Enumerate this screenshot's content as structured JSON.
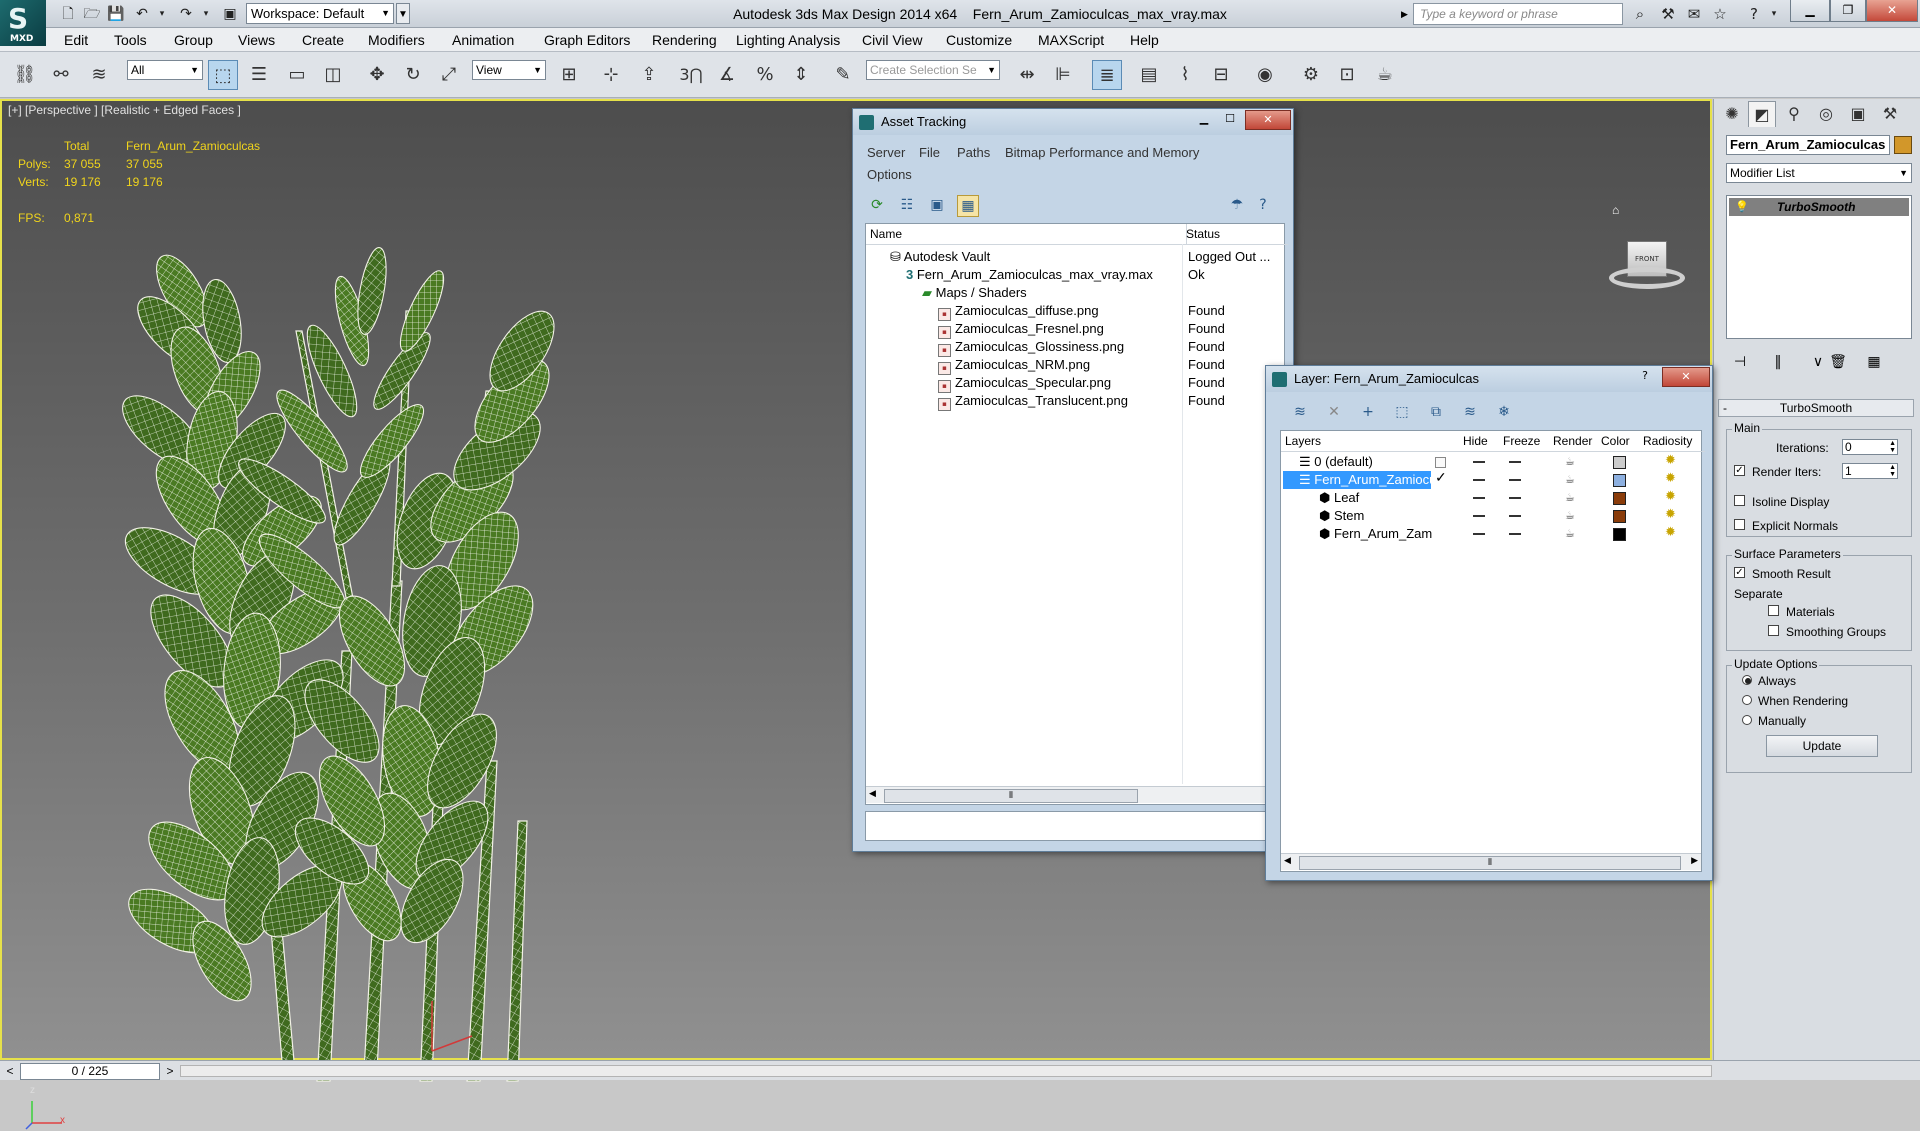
{
  "titlebar": {
    "app_title": "Autodesk 3ds Max Design 2014 x64",
    "file_title": "Fern_Arum_Zamioculcas_max_vray.max",
    "workspace": "Workspace: Default",
    "search_placeholder": "Type a keyword or phrase",
    "logo_text": "MXD"
  },
  "menu": [
    "Edit",
    "Tools",
    "Group",
    "Views",
    "Create",
    "Modifiers",
    "Animation",
    "Graph Editors",
    "Rendering",
    "Lighting Analysis",
    "Civil View",
    "Customize",
    "MAXScript",
    "Help"
  ],
  "toolbar": {
    "filter": "All",
    "ref_coord": "View",
    "selection_set": "Create Selection Se",
    "snap_label": "3"
  },
  "viewport": {
    "label": "[+] [Perspective ] [Realistic + Edged Faces ]",
    "stats": {
      "total_label": "Total",
      "object_label": "Fern_Arum_Zamioculcas",
      "polys_label": "Polys:",
      "polys_total": "37 055",
      "polys_object": "37 055",
      "verts_label": "Verts:",
      "verts_total": "19 176",
      "verts_object": "19 176",
      "fps_label": "FPS:",
      "fps_value": "0,871"
    },
    "viewcube_face": "FRONT",
    "axis_z": "z",
    "axis_x": "x"
  },
  "timeline": {
    "position": "0 / 225",
    "prev": "<",
    "next": ">"
  },
  "asset_tracking": {
    "title": "Asset Tracking",
    "menu": [
      "Server",
      "File",
      "Paths",
      "Bitmap Performance and Memory",
      "Options"
    ],
    "columns": {
      "name": "Name",
      "status": "Status"
    },
    "rows": [
      {
        "name": "Autodesk Vault",
        "status": "Logged Out ..."
      },
      {
        "name": "Fern_Arum_Zamioculcas_max_vray.max",
        "status": "Ok"
      },
      {
        "name": "Maps / Shaders",
        "status": ""
      },
      {
        "name": "Zamioculcas_diffuse.png",
        "status": "Found"
      },
      {
        "name": "Zamioculcas_Fresnel.png",
        "status": "Found"
      },
      {
        "name": "Zamioculcas_Glossiness.png",
        "status": "Found"
      },
      {
        "name": "Zamioculcas_NRM.png",
        "status": "Found"
      },
      {
        "name": "Zamioculcas_Specular.png",
        "status": "Found"
      },
      {
        "name": "Zamioculcas_Translucent.png",
        "status": "Found"
      }
    ]
  },
  "layer_dialog": {
    "title": "Layer: Fern_Arum_Zamioculcas",
    "help": "?",
    "columns": {
      "layers": "Layers",
      "hide": "Hide",
      "freeze": "Freeze",
      "render": "Render",
      "color": "Color",
      "radiosity": "Radiosity"
    },
    "rows": [
      {
        "name": "0 (default)",
        "color": "#cccccc"
      },
      {
        "name": "Fern_Arum_Zamiocu",
        "color": "#8db0e0"
      },
      {
        "name": "Leaf",
        "color": "#8a3c0a"
      },
      {
        "name": "Stem",
        "color": "#8a3c0a"
      },
      {
        "name": "Fern_Arum_Zam",
        "color": "#000000"
      }
    ]
  },
  "command_panel": {
    "object_name": "Fern_Arum_Zamioculcas",
    "object_color": "#d2972a",
    "modifier_list": "Modifier List",
    "stack_item": "TurboSmooth",
    "rollout_title": "TurboSmooth",
    "rollout_toggle": "-",
    "main_group": "Main",
    "iterations_label": "Iterations:",
    "iterations_value": "0",
    "render_iters_label": "Render Iters:",
    "render_iters_value": "1",
    "render_iters_checked": "✓",
    "isoline_display": "Isoline Display",
    "explicit_normals": "Explicit Normals",
    "surface_params": "Surface Parameters",
    "smooth_result": "Smooth Result",
    "smooth_result_checked": "✓",
    "separate": "Separate",
    "materials": "Materials",
    "smoothing_groups": "Smoothing Groups",
    "update_options": "Update Options",
    "always": "Always",
    "when_rendering": "When Rendering",
    "manually": "Manually",
    "update_button": "Update"
  },
  "colors": {
    "viewport_border": "#e6e14a",
    "stats_text": "#f0d41c",
    "selection": "#3399ff",
    "dialog_frame": "#c4d5e6"
  }
}
